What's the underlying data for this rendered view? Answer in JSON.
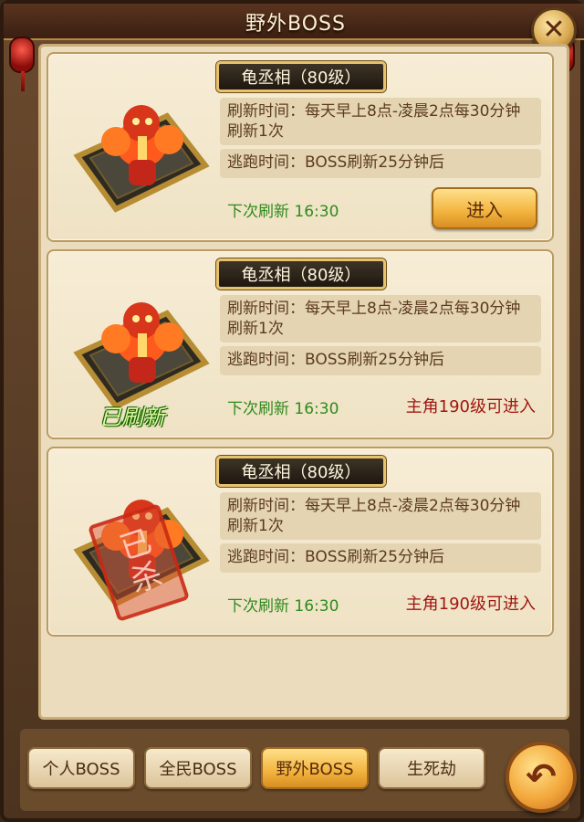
{
  "window": {
    "title": "野外BOSS",
    "close_icon": "close-icon"
  },
  "boss_cards": [
    {
      "name": "龟丞相（80级）",
      "refresh_time": "刷新时间：每天早上8点-凌晨2点每30分钟刷新1次",
      "escape_time": "逃跑时间：BOSS刷新25分钟后",
      "next_refresh": "下次刷新  16:30",
      "action_label": "进入",
      "status": "enterable"
    },
    {
      "name": "龟丞相（80级）",
      "refresh_time": "刷新时间：每天早上8点-凌晨2点每30分钟刷新1次",
      "escape_time": "逃跑时间：BOSS刷新25分钟后",
      "next_refresh": "下次刷新  16:30",
      "level_requirement": "主角190级可进入",
      "portrait_label": "已刷新",
      "status": "refreshed"
    },
    {
      "name": "龟丞相（80级）",
      "refresh_time": "刷新时间：每天早上8点-凌晨2点每30分钟刷新1次",
      "escape_time": "逃跑时间：BOSS刷新25分钟后",
      "next_refresh": "下次刷新  16:30",
      "level_requirement": "主角190级可进入",
      "stamp_label": "已杀",
      "status": "killed"
    }
  ],
  "tabs": [
    {
      "label": "个人BOSS",
      "active": false
    },
    {
      "label": "全民BOSS",
      "active": false
    },
    {
      "label": "野外BOSS",
      "active": true
    },
    {
      "label": "生死劫",
      "active": false
    }
  ],
  "back_button_icon": "back-arrow-icon",
  "colors": {
    "next_refresh": "#2f8a1d",
    "level_requirement": "#a01612",
    "accent_gold": "#f2b33e"
  }
}
